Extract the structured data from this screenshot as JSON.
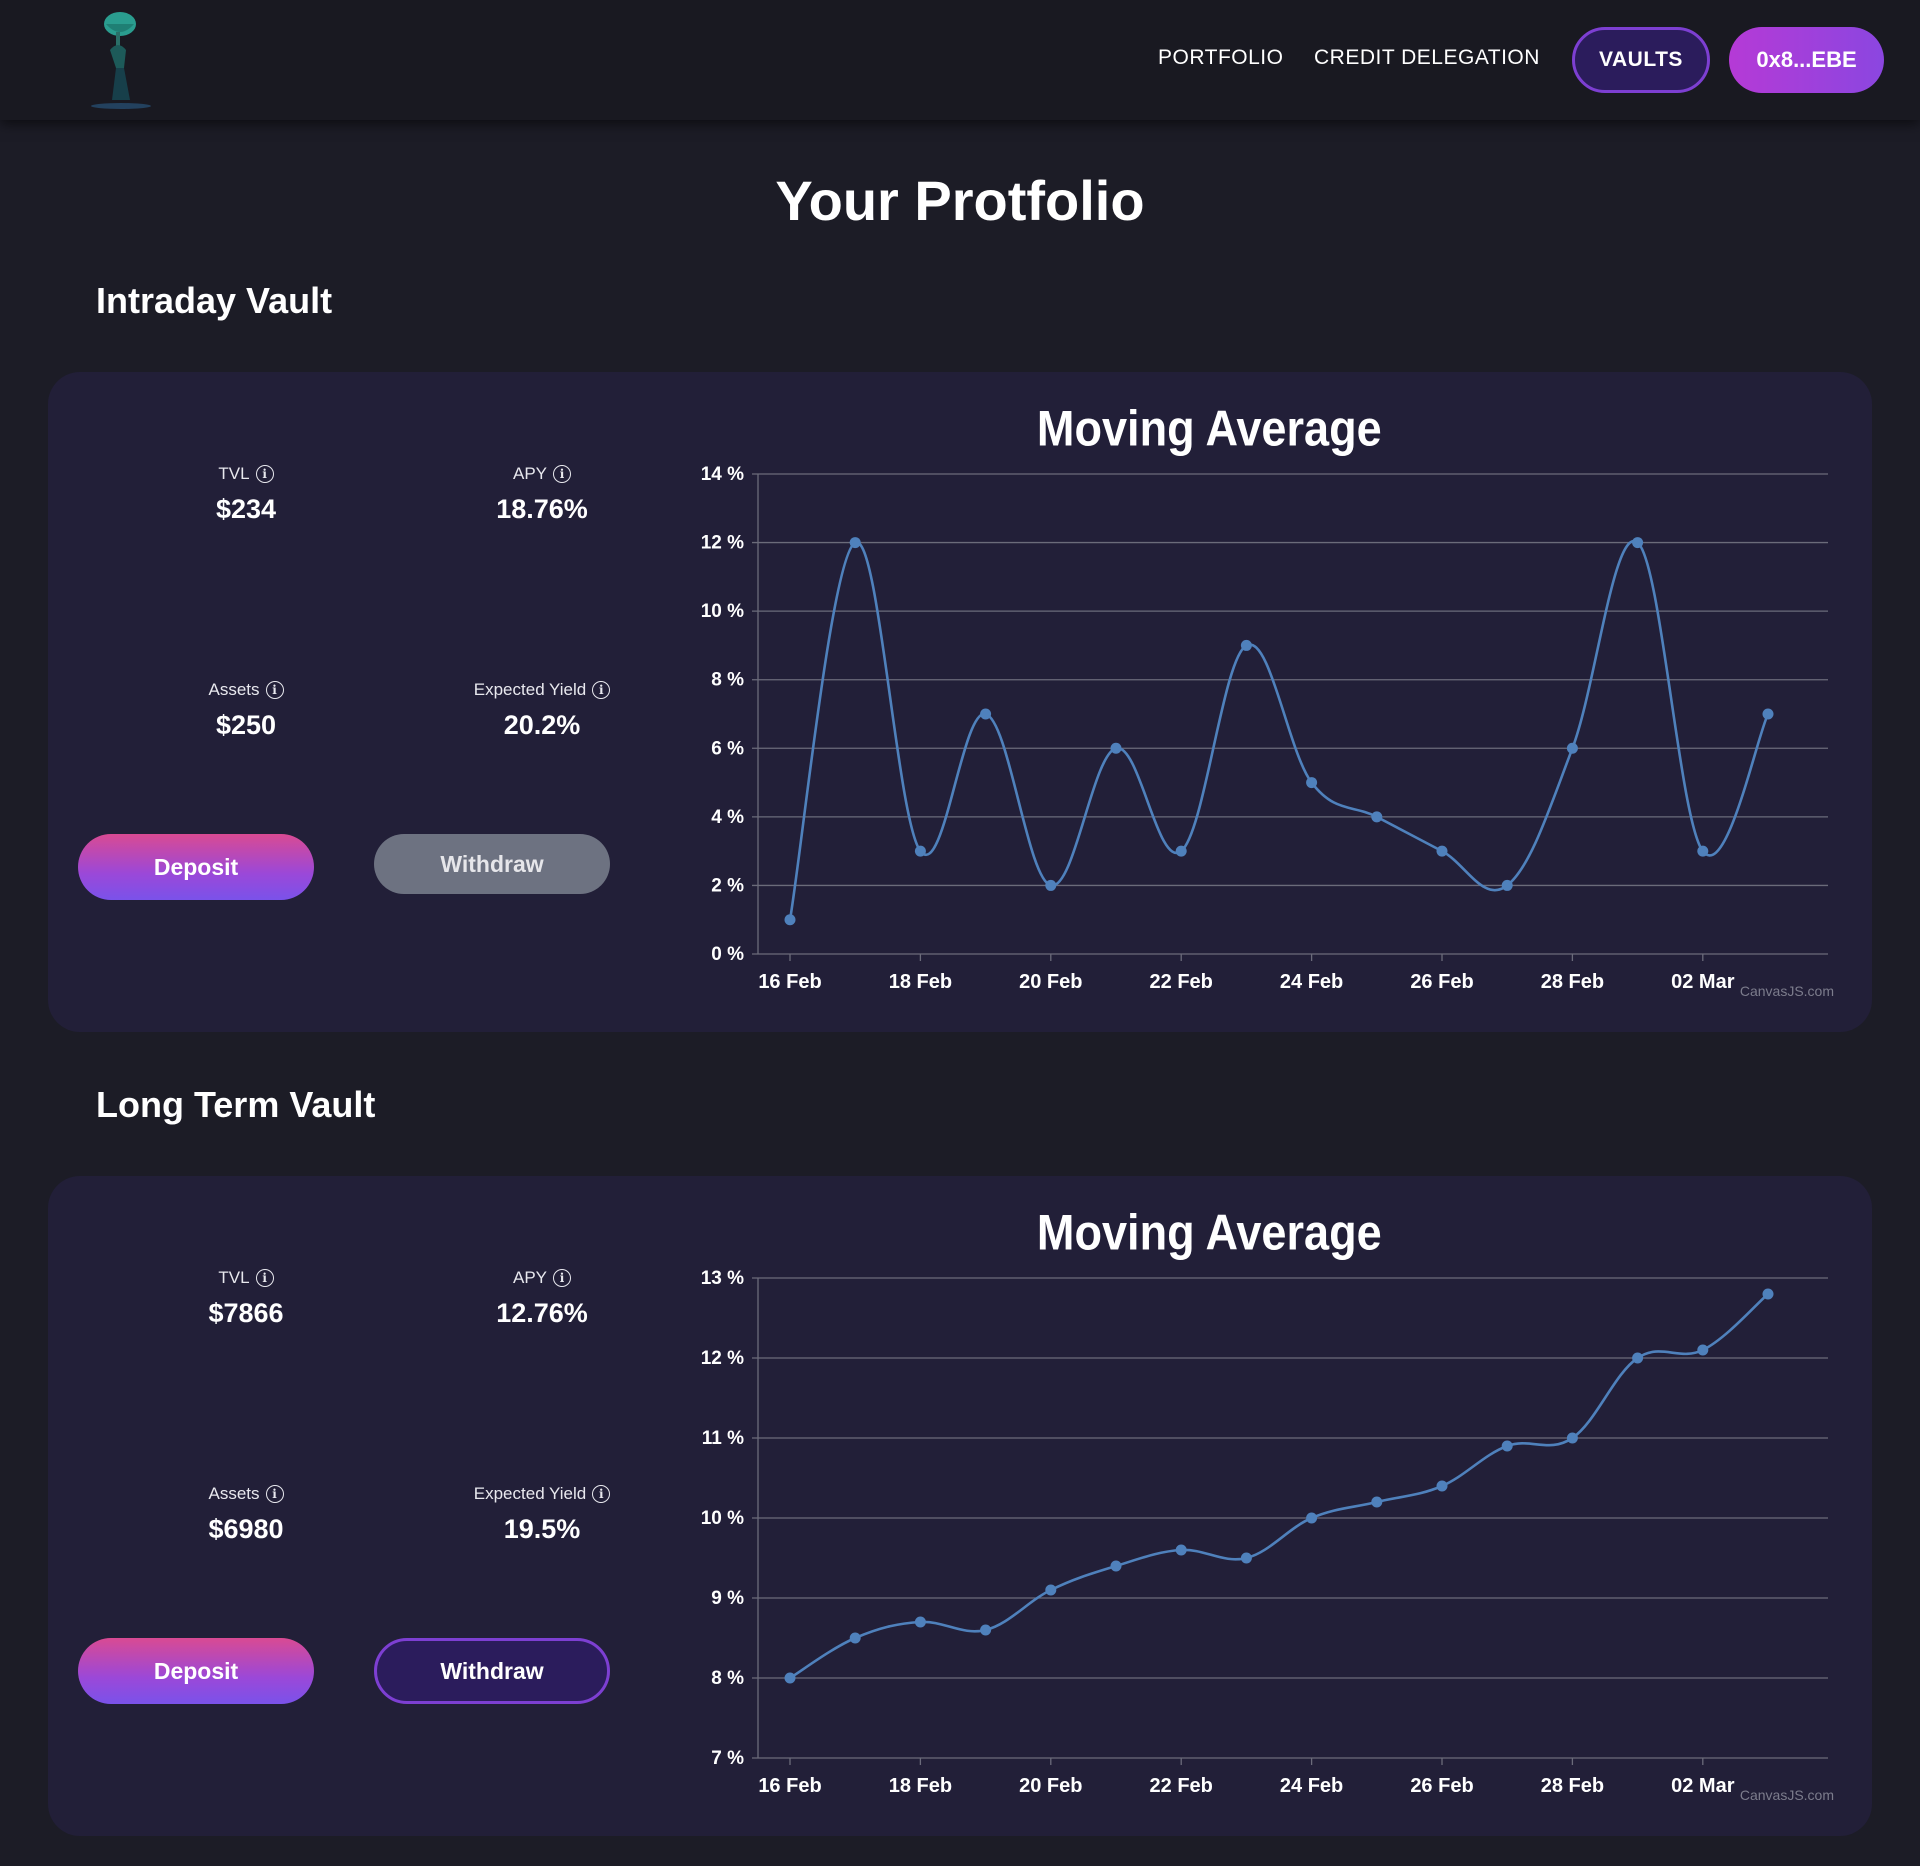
{
  "header": {
    "nav": {
      "portfolio": "PORTFOLIO",
      "credit_delegation": "CREDIT DELEGATION"
    },
    "vaults_button": "VAULTS",
    "wallet_button": "0x8...EBE",
    "logo_icon": "logo-figure-icon"
  },
  "page": {
    "title": "Your Protfolio"
  },
  "vaults": [
    {
      "name": "Intraday Vault",
      "stats": {
        "tvl_label": "TVL",
        "tvl_value": "$234",
        "apy_label": "APY",
        "apy_value": "18.76%",
        "assets_label": "Assets",
        "assets_value": "$250",
        "yield_label": "Expected Yield",
        "yield_value": "20.2%"
      },
      "buttons": {
        "deposit": "Deposit",
        "withdraw": "Withdraw",
        "withdraw_enabled": false
      },
      "chart_data": {
        "type": "line",
        "title": "Moving Average",
        "x": [
          "16 Feb",
          "17 Feb",
          "18 Feb",
          "19 Feb",
          "20 Feb",
          "21 Feb",
          "22 Feb",
          "23 Feb",
          "24 Feb",
          "25 Feb",
          "26 Feb",
          "27 Feb",
          "28 Feb",
          "01 Mar",
          "02 Mar",
          "03 Mar"
        ],
        "values": [
          1,
          12,
          3,
          7,
          2,
          6,
          3,
          9,
          5,
          4,
          3,
          2,
          6,
          12,
          3,
          7
        ],
        "ylim": [
          0,
          14
        ],
        "yticks": [
          0,
          2,
          4,
          6,
          8,
          10,
          12,
          14
        ],
        "ytick_labels": [
          "0 %",
          "2 %",
          "4 %",
          "6 %",
          "8 %",
          "10 %",
          "12 %",
          "14 %"
        ],
        "xtick_labels": [
          "16 Feb",
          "18 Feb",
          "20 Feb",
          "22 Feb",
          "24 Feb",
          "26 Feb",
          "28 Feb",
          "02 Mar"
        ],
        "grid": true,
        "credit": "CanvasJS.com"
      }
    },
    {
      "name": "Long Term Vault",
      "stats": {
        "tvl_label": "TVL",
        "tvl_value": "$7866",
        "apy_label": "APY",
        "apy_value": "12.76%",
        "assets_label": "Assets",
        "assets_value": "$6980",
        "yield_label": "Expected Yield",
        "yield_value": "19.5%"
      },
      "buttons": {
        "deposit": "Deposit",
        "withdraw": "Withdraw",
        "withdraw_enabled": true
      },
      "chart_data": {
        "type": "line",
        "title": "Moving Average",
        "x": [
          "16 Feb",
          "17 Feb",
          "18 Feb",
          "19 Feb",
          "20 Feb",
          "21 Feb",
          "22 Feb",
          "23 Feb",
          "24 Feb",
          "25 Feb",
          "26 Feb",
          "27 Feb",
          "28 Feb",
          "01 Mar",
          "02 Mar",
          "03 Mar"
        ],
        "values": [
          8.0,
          8.5,
          8.7,
          8.6,
          9.1,
          9.4,
          9.6,
          9.5,
          10.0,
          10.2,
          10.4,
          10.9,
          11.0,
          12.0,
          12.1,
          12.8
        ],
        "ylim": [
          7,
          13
        ],
        "yticks": [
          7,
          8,
          9,
          10,
          11,
          12,
          13
        ],
        "ytick_labels": [
          "7 %",
          "8 %",
          "9 %",
          "10 %",
          "11 %",
          "12 %",
          "13 %"
        ],
        "xtick_labels": [
          "16 Feb",
          "18 Feb",
          "20 Feb",
          "22 Feb",
          "24 Feb",
          "26 Feb",
          "28 Feb",
          "02 Mar"
        ],
        "grid": true,
        "credit": "CanvasJS.com"
      }
    }
  ],
  "colors": {
    "background": "#1c1c26",
    "card": "#221f38",
    "accent_purple": "#7d3fd2",
    "line_series": "#4f81bc",
    "gridline": "#6b6b7a"
  }
}
